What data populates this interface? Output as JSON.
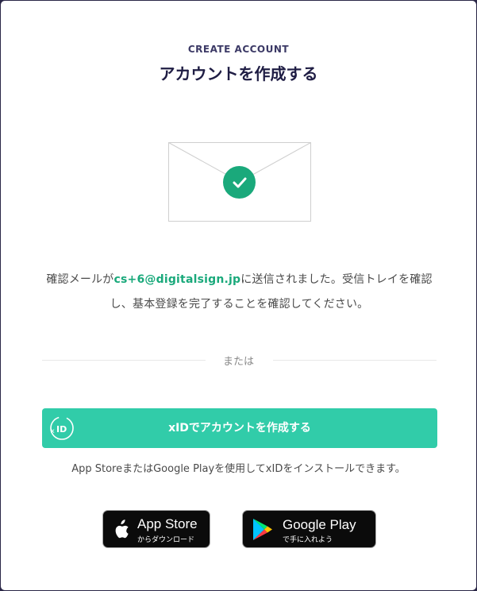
{
  "header": {
    "eyebrow": "CREATE ACCOUNT",
    "title": "アカウントを作成する"
  },
  "confirmation": {
    "prefix": "確認メールが",
    "email": "cs+6@digitalsign.jp",
    "suffix_line1": "に送信されました。受信トレイを確認",
    "line2": "し、基本登録を完了することを確認してください。"
  },
  "divider": {
    "label": "または"
  },
  "xid": {
    "button_label": "xIDでアカウントを作成する",
    "install_note": "App StoreまたはGoogle Playを使用してxIDをインストールできます。"
  },
  "stores": {
    "apple_title": "App Store",
    "apple_sub": "からダウンロード",
    "google_title": "Google Play",
    "google_sub": "で手に入れよう"
  },
  "colors": {
    "accent": "#1aa97b",
    "button": "#31cca9",
    "title": "#1f1d44",
    "frame": "#2a2747"
  }
}
